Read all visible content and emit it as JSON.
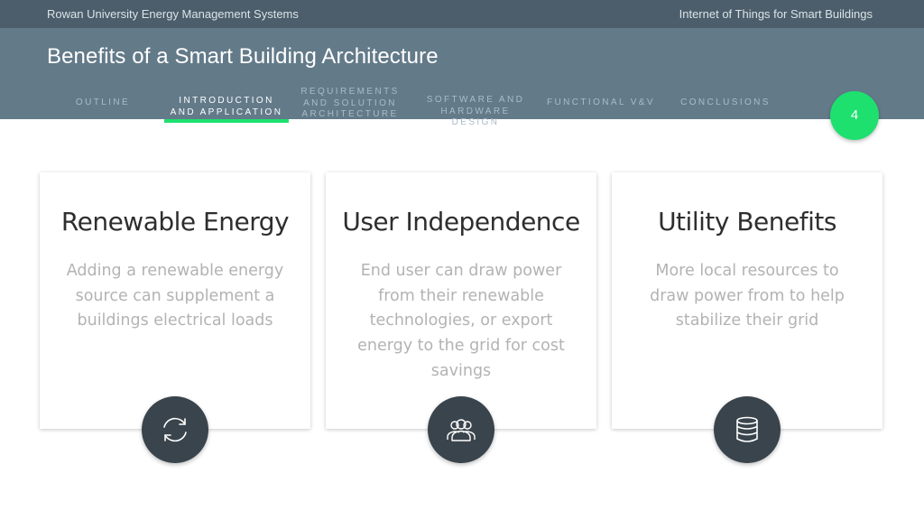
{
  "topbar": {
    "left_text": "Rowan University Energy Management Systems",
    "right_text": "Internet of Things for Smart Buildings"
  },
  "header": {
    "title": "Benefits of a Smart Building Architecture",
    "tabs": [
      {
        "line1": "OUTLINE",
        "line2": "",
        "line3": "",
        "active": false
      },
      {
        "line1": "INTRODUCTION",
        "line2": "AND APPLICATION",
        "line3": "",
        "active": true
      },
      {
        "line1": "REQUIREMENTS",
        "line2": "AND SOLUTION",
        "line3": "ARCHITECTURE",
        "active": false
      },
      {
        "line1": "SOFTWARE AND",
        "line2": "HARDWARE DESIGN",
        "line3": "",
        "active": false
      },
      {
        "line1": "FUNCTIONAL V&V",
        "line2": "",
        "line3": "",
        "active": false
      },
      {
        "line1": "CONCLUSIONS",
        "line2": "",
        "line3": "",
        "active": false
      }
    ],
    "page_number": "4"
  },
  "cards": [
    {
      "title": "Renewable Energy",
      "body": "Adding a renewable energy source can supplement a buildings electrical loads",
      "icon": "refresh-icon"
    },
    {
      "title": "User Independence",
      "body": "End user can draw power from their renewable technologies, or export energy to the grid for cost savings",
      "icon": "users-icon"
    },
    {
      "title": "Utility Benefits",
      "body": "More local resources to draw power from to help stabilize their grid",
      "icon": "database-icon"
    }
  ],
  "colors": {
    "topbar": "#4c5e6b",
    "header": "#637a89",
    "accent": "#1ee06f",
    "icon_circle": "#3a444c"
  }
}
